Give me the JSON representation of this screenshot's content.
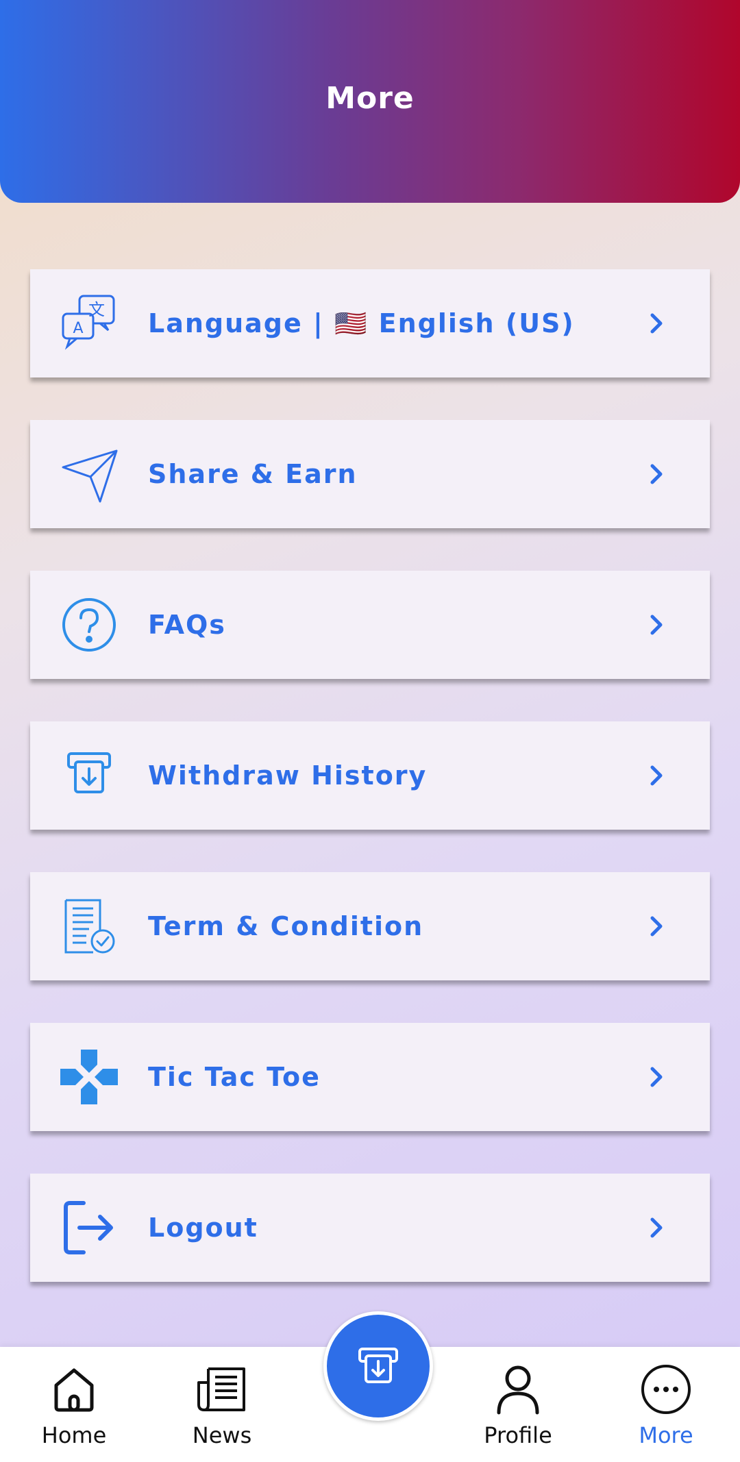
{
  "header": {
    "title": "More"
  },
  "menu": {
    "items": [
      {
        "label": "Language | 🇺🇸 English (US)",
        "icon": "translate-icon"
      },
      {
        "label": "Share & Earn",
        "icon": "paper-plane-icon"
      },
      {
        "label": "FAQs",
        "icon": "question-circle-icon"
      },
      {
        "label": "Withdraw History",
        "icon": "withdraw-icon"
      },
      {
        "label": "Term & Condition",
        "icon": "document-check-icon"
      },
      {
        "label": "Tic Tac Toe",
        "icon": "game-cross-icon"
      },
      {
        "label": "Logout",
        "icon": "logout-icon"
      }
    ]
  },
  "bottom_nav": {
    "items": [
      {
        "label": "Home",
        "icon": "home-icon"
      },
      {
        "label": "News",
        "icon": "newspaper-icon"
      },
      {
        "label": "Profile",
        "icon": "user-icon"
      },
      {
        "label": "More",
        "icon": "more-dots-icon",
        "active": true
      }
    ],
    "fab": {
      "icon": "withdraw-icon"
    }
  },
  "colors": {
    "accent": "#2e6ee8",
    "header_gradient_start": "#2e6ee8",
    "header_gradient_end": "#b0062c"
  }
}
